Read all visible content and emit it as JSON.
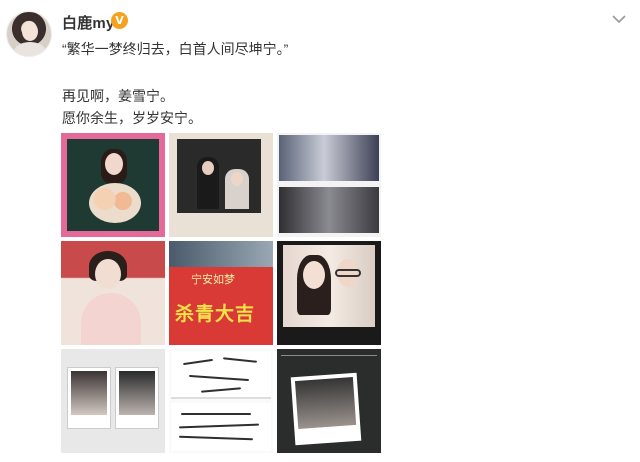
{
  "post": {
    "username": "白鹿my",
    "verified_badge": "V",
    "lines": [
      "“繁华一梦终归去，白首人间尽坤宁。”",
      "再见啊，姜雪宁。",
      "愿你余生，岁岁安宁。"
    ],
    "banner_text_top": "宁安如梦",
    "banner_text_main": "杀青大吉"
  },
  "icons": {
    "more": "chevron-down-icon",
    "verified": "verified-badge-icon"
  },
  "colors": {
    "verified_badge": "#f4a21f",
    "text": "#333333",
    "banner_red": "#d93a35"
  }
}
